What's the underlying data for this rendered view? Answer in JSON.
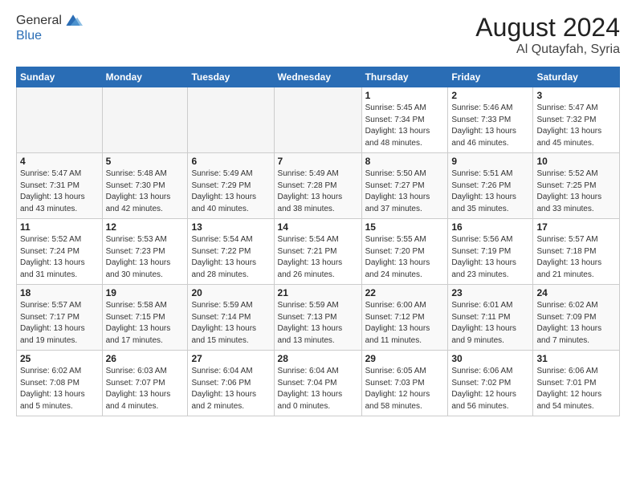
{
  "header": {
    "logo_line1": "General",
    "logo_line2": "Blue",
    "month_year": "August 2024",
    "location": "Al Qutayfah, Syria"
  },
  "weekdays": [
    "Sunday",
    "Monday",
    "Tuesday",
    "Wednesday",
    "Thursday",
    "Friday",
    "Saturday"
  ],
  "weeks": [
    [
      {
        "day": "",
        "info": ""
      },
      {
        "day": "",
        "info": ""
      },
      {
        "day": "",
        "info": ""
      },
      {
        "day": "",
        "info": ""
      },
      {
        "day": "1",
        "info": "Sunrise: 5:45 AM\nSunset: 7:34 PM\nDaylight: 13 hours\nand 48 minutes."
      },
      {
        "day": "2",
        "info": "Sunrise: 5:46 AM\nSunset: 7:33 PM\nDaylight: 13 hours\nand 46 minutes."
      },
      {
        "day": "3",
        "info": "Sunrise: 5:47 AM\nSunset: 7:32 PM\nDaylight: 13 hours\nand 45 minutes."
      }
    ],
    [
      {
        "day": "4",
        "info": "Sunrise: 5:47 AM\nSunset: 7:31 PM\nDaylight: 13 hours\nand 43 minutes."
      },
      {
        "day": "5",
        "info": "Sunrise: 5:48 AM\nSunset: 7:30 PM\nDaylight: 13 hours\nand 42 minutes."
      },
      {
        "day": "6",
        "info": "Sunrise: 5:49 AM\nSunset: 7:29 PM\nDaylight: 13 hours\nand 40 minutes."
      },
      {
        "day": "7",
        "info": "Sunrise: 5:49 AM\nSunset: 7:28 PM\nDaylight: 13 hours\nand 38 minutes."
      },
      {
        "day": "8",
        "info": "Sunrise: 5:50 AM\nSunset: 7:27 PM\nDaylight: 13 hours\nand 37 minutes."
      },
      {
        "day": "9",
        "info": "Sunrise: 5:51 AM\nSunset: 7:26 PM\nDaylight: 13 hours\nand 35 minutes."
      },
      {
        "day": "10",
        "info": "Sunrise: 5:52 AM\nSunset: 7:25 PM\nDaylight: 13 hours\nand 33 minutes."
      }
    ],
    [
      {
        "day": "11",
        "info": "Sunrise: 5:52 AM\nSunset: 7:24 PM\nDaylight: 13 hours\nand 31 minutes."
      },
      {
        "day": "12",
        "info": "Sunrise: 5:53 AM\nSunset: 7:23 PM\nDaylight: 13 hours\nand 30 minutes."
      },
      {
        "day": "13",
        "info": "Sunrise: 5:54 AM\nSunset: 7:22 PM\nDaylight: 13 hours\nand 28 minutes."
      },
      {
        "day": "14",
        "info": "Sunrise: 5:54 AM\nSunset: 7:21 PM\nDaylight: 13 hours\nand 26 minutes."
      },
      {
        "day": "15",
        "info": "Sunrise: 5:55 AM\nSunset: 7:20 PM\nDaylight: 13 hours\nand 24 minutes."
      },
      {
        "day": "16",
        "info": "Sunrise: 5:56 AM\nSunset: 7:19 PM\nDaylight: 13 hours\nand 23 minutes."
      },
      {
        "day": "17",
        "info": "Sunrise: 5:57 AM\nSunset: 7:18 PM\nDaylight: 13 hours\nand 21 minutes."
      }
    ],
    [
      {
        "day": "18",
        "info": "Sunrise: 5:57 AM\nSunset: 7:17 PM\nDaylight: 13 hours\nand 19 minutes."
      },
      {
        "day": "19",
        "info": "Sunrise: 5:58 AM\nSunset: 7:15 PM\nDaylight: 13 hours\nand 17 minutes."
      },
      {
        "day": "20",
        "info": "Sunrise: 5:59 AM\nSunset: 7:14 PM\nDaylight: 13 hours\nand 15 minutes."
      },
      {
        "day": "21",
        "info": "Sunrise: 5:59 AM\nSunset: 7:13 PM\nDaylight: 13 hours\nand 13 minutes."
      },
      {
        "day": "22",
        "info": "Sunrise: 6:00 AM\nSunset: 7:12 PM\nDaylight: 13 hours\nand 11 minutes."
      },
      {
        "day": "23",
        "info": "Sunrise: 6:01 AM\nSunset: 7:11 PM\nDaylight: 13 hours\nand 9 minutes."
      },
      {
        "day": "24",
        "info": "Sunrise: 6:02 AM\nSunset: 7:09 PM\nDaylight: 13 hours\nand 7 minutes."
      }
    ],
    [
      {
        "day": "25",
        "info": "Sunrise: 6:02 AM\nSunset: 7:08 PM\nDaylight: 13 hours\nand 5 minutes."
      },
      {
        "day": "26",
        "info": "Sunrise: 6:03 AM\nSunset: 7:07 PM\nDaylight: 13 hours\nand 4 minutes."
      },
      {
        "day": "27",
        "info": "Sunrise: 6:04 AM\nSunset: 7:06 PM\nDaylight: 13 hours\nand 2 minutes."
      },
      {
        "day": "28",
        "info": "Sunrise: 6:04 AM\nSunset: 7:04 PM\nDaylight: 13 hours\nand 0 minutes."
      },
      {
        "day": "29",
        "info": "Sunrise: 6:05 AM\nSunset: 7:03 PM\nDaylight: 12 hours\nand 58 minutes."
      },
      {
        "day": "30",
        "info": "Sunrise: 6:06 AM\nSunset: 7:02 PM\nDaylight: 12 hours\nand 56 minutes."
      },
      {
        "day": "31",
        "info": "Sunrise: 6:06 AM\nSunset: 7:01 PM\nDaylight: 12 hours\nand 54 minutes."
      }
    ]
  ]
}
